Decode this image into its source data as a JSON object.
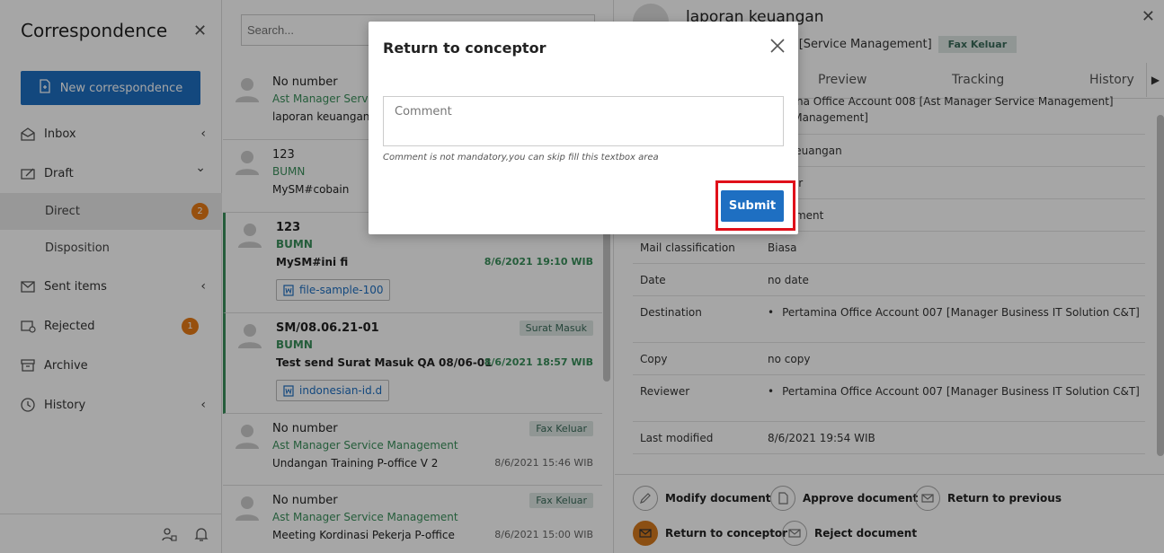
{
  "sidebar": {
    "title": "Correspondence",
    "new_button": "New correspondence",
    "items": [
      {
        "label": "Inbox",
        "icon": "inbox-icon",
        "chevron": "‹"
      },
      {
        "label": "Draft",
        "icon": "draft-icon",
        "chevron": "⌄"
      },
      {
        "label": "Direct",
        "badge": "2"
      },
      {
        "label": "Disposition"
      },
      {
        "label": "Sent items",
        "icon": "sent-icon",
        "chevron": "‹"
      },
      {
        "label": "Rejected",
        "icon": "rejected-icon",
        "badge": "1"
      },
      {
        "label": "Archive",
        "icon": "archive-icon"
      },
      {
        "label": "History",
        "icon": "history-icon",
        "chevron": "‹"
      }
    ]
  },
  "list": {
    "search_placeholder": "Search...",
    "rows": [
      {
        "number": "No number",
        "from": "Ast Manager Servic",
        "subject": "laporan keuangan"
      },
      {
        "number": "123",
        "from": "BUMN",
        "subject": "MySM#cobain"
      },
      {
        "number": "123",
        "from": "BUMN",
        "subject": "MySM#ini fi",
        "date": "8/6/2021 19:10 WIB",
        "attachment": "file-sample-100"
      },
      {
        "number": "SM/08.06.21-01",
        "tag": "Surat Masuk",
        "from": "BUMN",
        "subject": "Test send Surat Masuk QA 08/06-01",
        "date": "8/6/2021 18:57 WIB",
        "attachment": "indonesian-id.d"
      },
      {
        "number": "No number",
        "tag": "Fax Keluar",
        "from": "Ast Manager Service Management",
        "subject": "Undangan Training P-office V 2",
        "date": "8/6/2021 15:46 WIB"
      },
      {
        "number": "No number",
        "tag": "Fax Keluar",
        "from": "Ast Manager Service Management",
        "subject": "Meeting Kordinasi Pekerja P-office",
        "date": "8/6/2021 15:00 WIB"
      }
    ]
  },
  "detail": {
    "title": "laporan keuangan",
    "subtitle": "rvice Management [Service Management]",
    "tag": "Fax Keluar",
    "tabs": [
      "Preview",
      "Tracking",
      "History"
    ],
    "tab_more": "▶",
    "props": [
      {
        "key": "",
        "value": "rtamina Office Account 008 [Ast Manager Service Management]"
      },
      {
        "key": "",
        "value": "vice Management]"
      },
      {
        "key": "",
        "value": "ran keuangan"
      },
      {
        "key": "",
        "value": "umber"
      },
      {
        "key": "",
        "value": "ttachment"
      },
      {
        "key": "Mail classification",
        "value": "Biasa"
      },
      {
        "key": "Date",
        "value": "no date"
      },
      {
        "key": "Destination",
        "value": "Pertamina Office Account 007 [Manager Business IT Solution C&T]"
      },
      {
        "key": "Copy",
        "value": "no copy"
      },
      {
        "key": "Reviewer",
        "value": "Pertamina Office Account 007 [Manager Business IT Solution C&T]"
      },
      {
        "key": "Last modified",
        "value": "8/6/2021 19:54 WIB"
      }
    ],
    "actions": {
      "modify": "Modify document",
      "approve": "Approve document",
      "return_previous": "Return to previous",
      "return_conceptor": "Return to conceptor",
      "reject": "Reject document"
    }
  },
  "modal": {
    "title": "Return to conceptor",
    "comment_placeholder": "Comment",
    "hint": "Comment is not mandatory,you can skip fill this textbox area",
    "submit": "Submit"
  },
  "colors": {
    "primary": "#1e6fc2",
    "green": "#3a8f5b",
    "badge_orange": "#e87c16",
    "highlight_red": "#e0101a"
  }
}
